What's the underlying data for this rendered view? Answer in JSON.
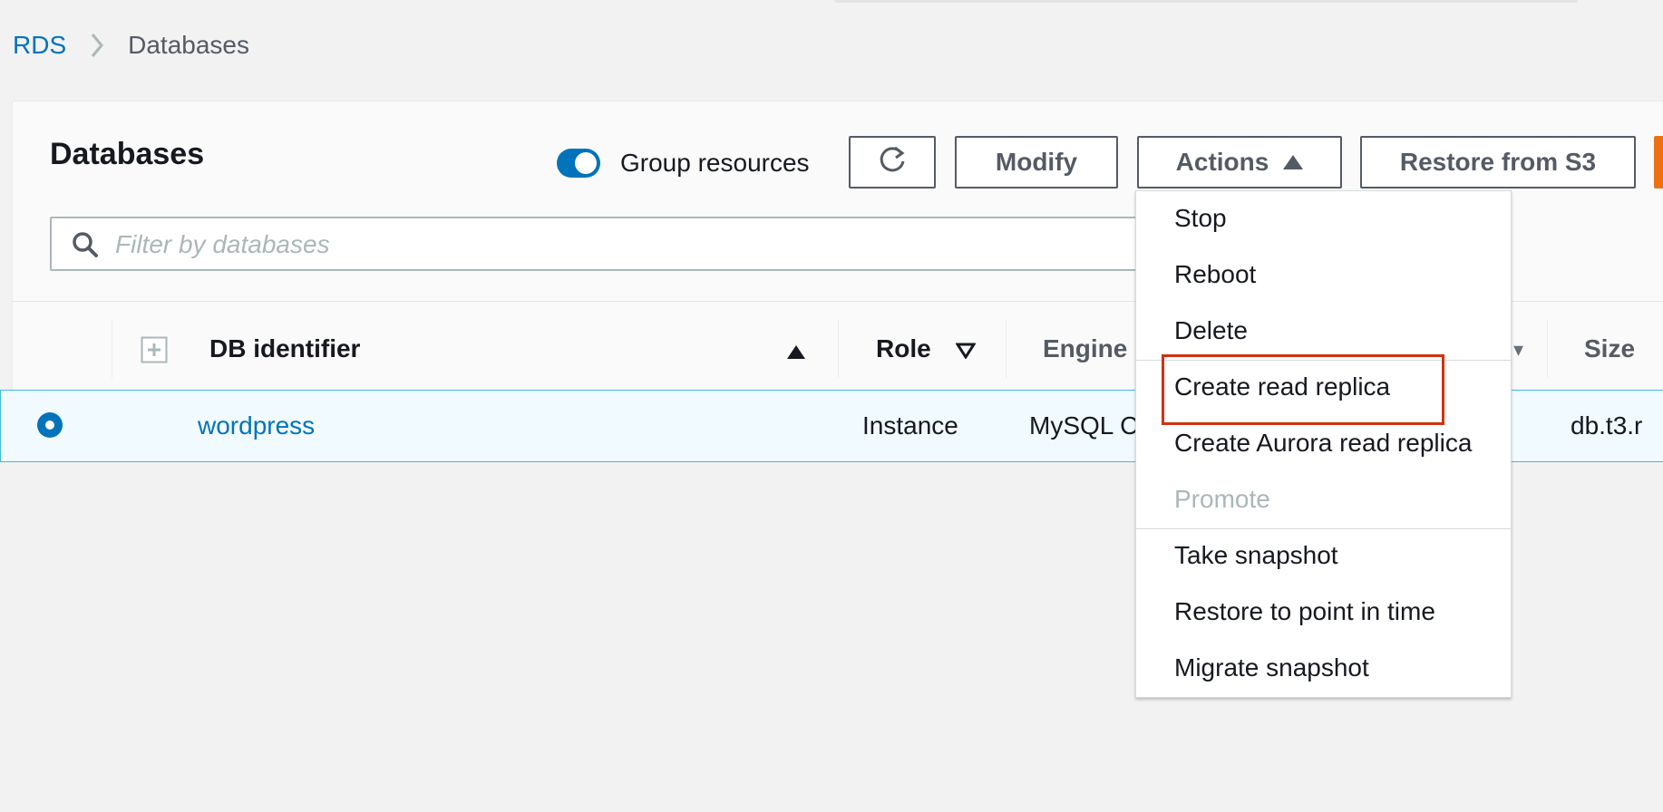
{
  "breadcrumb": {
    "root": "RDS",
    "current": "Databases"
  },
  "panel": {
    "title": "Databases",
    "group_resources_label": "Group resources",
    "group_resources_on": true,
    "buttons": {
      "modify": "Modify",
      "actions": "Actions",
      "restore": "Restore from S3"
    },
    "search_placeholder": "Filter by databases"
  },
  "table": {
    "headers": {
      "db_identifier": "DB identifier",
      "role": "Role",
      "engine": "Engine",
      "size": "Size"
    },
    "rows": [
      {
        "selected": true,
        "db_identifier": "wordpress",
        "role": "Instance",
        "engine": "MySQL C",
        "size": "db.t3.r"
      }
    ]
  },
  "actions_menu": {
    "items": [
      {
        "label": "Stop",
        "disabled": false
      },
      {
        "label": "Reboot",
        "disabled": false
      },
      {
        "label": "Delete",
        "disabled": false
      },
      {
        "label": "Create read replica",
        "disabled": false,
        "highlighted": true
      },
      {
        "label": "Create Aurora read replica",
        "disabled": false
      },
      {
        "label": "Promote",
        "disabled": true
      },
      {
        "label": "Take snapshot",
        "disabled": false
      },
      {
        "label": "Restore to point in time",
        "disabled": false
      },
      {
        "label": "Migrate snapshot",
        "disabled": false
      }
    ]
  },
  "colors": {
    "link": "#0073bb",
    "primary_button": "#ec7211",
    "highlight_border": "#d13212",
    "selected_row": "#f1faff"
  }
}
